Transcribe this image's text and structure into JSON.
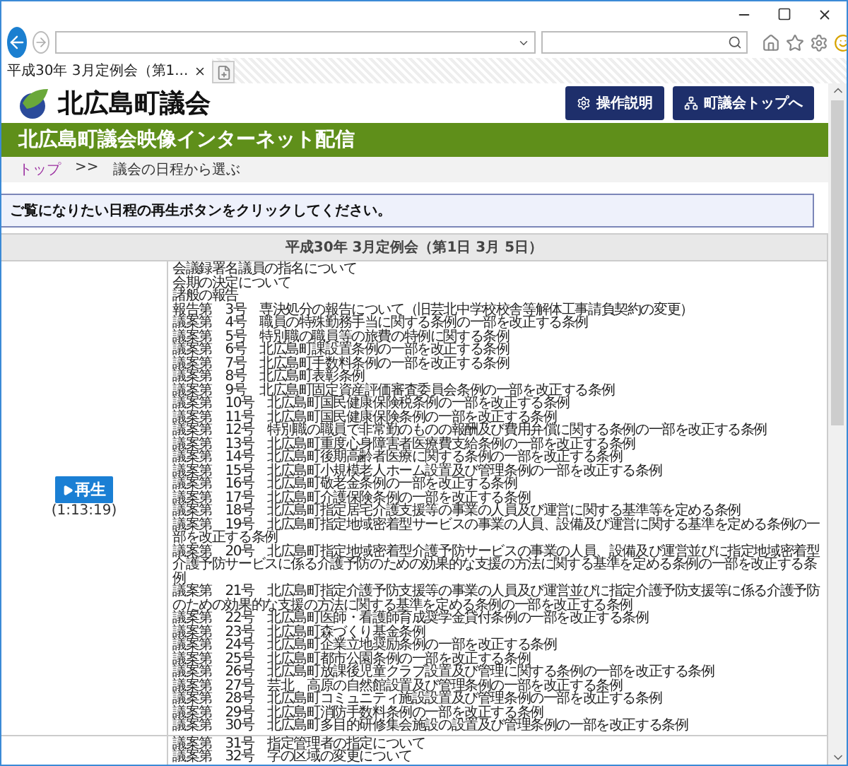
{
  "browser": {
    "tab": {
      "title": "平成30年 3月定例会（第1..."
    }
  },
  "site": {
    "name": "北広島町議会",
    "buttons": [
      {
        "label": "操作説明"
      },
      {
        "label": "町議会トップへ"
      }
    ]
  },
  "banner": "北広島町議会映像インターネット配信",
  "breadcrumb": [
    {
      "label": "トップ",
      "kind": "link"
    },
    {
      "label": ">>",
      "kind": "separator"
    },
    {
      "label": "議会の日程から選ぶ",
      "kind": "current"
    }
  ],
  "notice": "ご覧になりたい日程の再生ボタンをクリックしてください。",
  "schedule": {
    "title": "平成30年 3月定例会（第1日 3月 5日）",
    "sessions": [
      {
        "play_label": "再生",
        "duration": "(1:13:19)",
        "items": [
          "会議録署名議員の指名について",
          "会期の決定について",
          "諸般の報告",
          "報告第　3号　専決処分の報告について（旧芸北中学校校舎等解体工事請負契約の変更）",
          "議案第　4号　職員の特殊勤務手当に関する条例の一部を改正する条例",
          "議案第　5号　特別職の職員等の旅費の特例に関する条例",
          "議案第　6号　北広島町課設置条例の一部を改正する条例",
          "議案第　7号　北広島町手数料条例の一部を改正する条例",
          "議案第　8号　北広島町表彰条例",
          "議案第　9号　北広島町固定資産評価審査委員会条例の一部を改正する条例",
          "議案第　10号　北広島町国民健康保険税条例の一部を改正する条例",
          "議案第　11号　北広島町国民健康保険条例の一部を改正する条例",
          "議案第　12号　特別職の職員で非常勤のものの報酬及び費用弁償に関する条例の一部を改正する条例",
          "議案第　13号　北広島町重度心身障害者医療費支給条例の一部を改正する条例",
          "議案第　14号　北広島町後期高齢者医療に関する条例の一部を改正する条例",
          "議案第　15号　北広島町小規模老人ホーム設置及び管理条例の一部を改正する条例",
          "議案第　16号　北広島町敬老金条例の一部を改正する条例",
          "議案第　17号　北広島町介護保険条例の一部を改正する条例",
          "議案第　18号　北広島町指定居宅介護支援等の事業の人員及び運営に関する基準等を定める条例",
          "議案第　19号　北広島町指定地域密着型サービスの事業の人員、設備及び運営に関する基準を定める条例の一部を改正する条例",
          "議案第　20号　北広島町指定地域密着型介護予防サービスの事業の人員、設備及び運営並びに指定地域密着型介護予防サービスに係る介護予防のための効果的な支援の方法に関する基準を定める条例の一部を改正する条例",
          "議案第　21号　北広島町指定介護予防支援等の事業の人員及び運営並びに指定介護予防支援等に係る介護予防のための効果的な支援の方法に関する基準を定める条例の一部を改正する条例",
          "議案第　22号　北広島町医師・看護師育成奨学金貸付条例の一部を改正する条例",
          "議案第　23号　北広島町森づくり基金条例",
          "議案第　24号　北広島町企業立地奨励条例の一部を改正する条例",
          "議案第　25号　北広島町都市公園条例の一部を改正する条例",
          "議案第　26号　北広島町放課後児童クラブ設置及び管理に関する条例の一部を改正する条例",
          "議案第　27号　芸北　高原の自然館設置及び管理条例の一部を改正する条例",
          "議案第　28号　北広島町コミュニティ施設設置及び管理条例の一部を改正する条例",
          "議案第　29号　北広島町消防手数料条例の一部を改正する条例",
          "議案第　30号　北広島町多目的研修集会施設の設置及び管理条例の一部を改正する条例"
        ]
      },
      {
        "items": [
          "議案第　31号　指定管理者の指定について",
          "議案第　32号　字の区域の変更について"
        ]
      }
    ]
  }
}
